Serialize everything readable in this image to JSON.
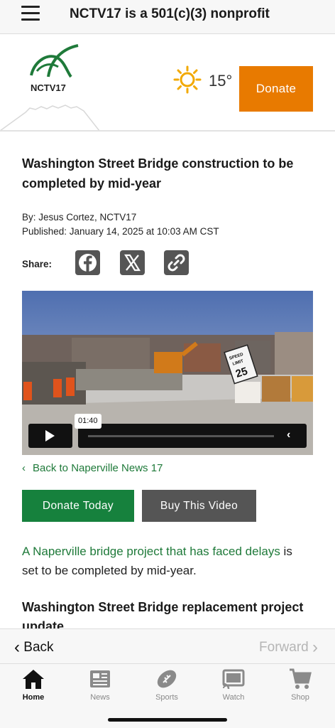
{
  "topbar": {
    "title": "NCTV17 is a 501(c)(3) nonprofit"
  },
  "header": {
    "logo_text": "NCTV17",
    "temperature": "15°",
    "weather_icon": "sun-icon",
    "donate_label": "Donate",
    "accent_color": "#e87a00"
  },
  "article": {
    "title": "Washington Street Bridge construction to be completed by mid-year",
    "byline": "By: Jesus Cortez, NCTV17",
    "published": "Published: January 14, 2025 at 10:03 AM CST",
    "share_label": "Share:",
    "share_icons": [
      "facebook-icon",
      "x-icon",
      "link-icon"
    ],
    "video": {
      "time": "01:40",
      "sign_speed": "SPEED",
      "sign_limit": "LIMIT",
      "sign_value": "25"
    },
    "back_link": "Back to Naperville News 17",
    "donate_today": "Donate Today",
    "buy_video": "Buy This Video",
    "paragraph_link": "A Naperville bridge project that has faced delays",
    "paragraph_rest": " is set to be completed by mid-year.",
    "subheading": "Washington Street Bridge replacement project update",
    "link_color": "#1f7a3a"
  },
  "browser": {
    "back": "Back",
    "forward": "Forward"
  },
  "tabs": [
    {
      "label": "Home",
      "icon": "home-icon",
      "active": true
    },
    {
      "label": "News",
      "icon": "newspaper-icon",
      "active": false
    },
    {
      "label": "Sports",
      "icon": "football-icon",
      "active": false
    },
    {
      "label": "Watch",
      "icon": "cast-icon",
      "active": false
    },
    {
      "label": "Shop",
      "icon": "cart-icon",
      "active": false
    }
  ]
}
